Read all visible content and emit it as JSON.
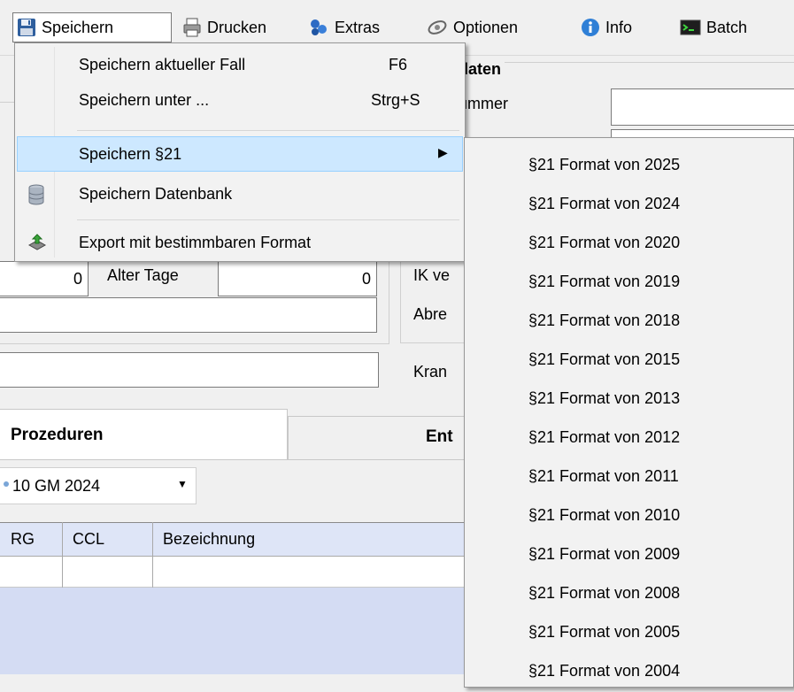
{
  "menubar": {
    "items": [
      {
        "label": "Speichern",
        "icon": "floppy-disk-icon"
      },
      {
        "label": "Drucken",
        "icon": "printer-icon"
      },
      {
        "label": "Extras",
        "icon": "puzzle-icon"
      },
      {
        "label": "Optionen",
        "icon": "options-icon"
      },
      {
        "label": "Info",
        "icon": "info-icon"
      },
      {
        "label": "Batch",
        "icon": "terminal-icon"
      }
    ]
  },
  "form": {
    "header_fragment": "daten",
    "label_nummer": "ummer",
    "age_days_label": "Alter Tage",
    "age_years_value": "0",
    "age_days_value": "0",
    "label_ik": "IK ve",
    "label_abrec": "Abre",
    "label_kran": "Kran"
  },
  "tabs": [
    {
      "label": "Prozeduren"
    },
    {
      "label": "Ent"
    }
  ],
  "gm_select": {
    "value": "10 GM 2024"
  },
  "table": {
    "columns": [
      "RG",
      "CCL",
      "Bezeichnung"
    ]
  },
  "dropdown": {
    "items": [
      {
        "label": "Speichern aktueller Fall",
        "shortcut": "F6"
      },
      {
        "label": "Speichern unter ...",
        "shortcut": "Strg+S"
      },
      {
        "label": "Speichern §21",
        "arrow": "▶"
      },
      {
        "label": "Speichern Datenbank",
        "icon": "database-icon"
      },
      {
        "label": "Export mit bestimmbaren Format",
        "icon": "export-icon"
      }
    ]
  },
  "submenu": {
    "items": [
      "§21 Format von 2025",
      "§21 Format von 2024",
      "§21 Format von 2020",
      "§21 Format von 2019",
      "§21 Format von 2018",
      "§21 Format von 2015",
      "§21 Format von 2013",
      "§21 Format von 2012",
      "§21 Format von 2011",
      "§21 Format von 2010",
      "§21 Format von 2009",
      "§21 Format von 2008",
      "§21 Format von 2005",
      "§21 Format von 2004"
    ]
  }
}
